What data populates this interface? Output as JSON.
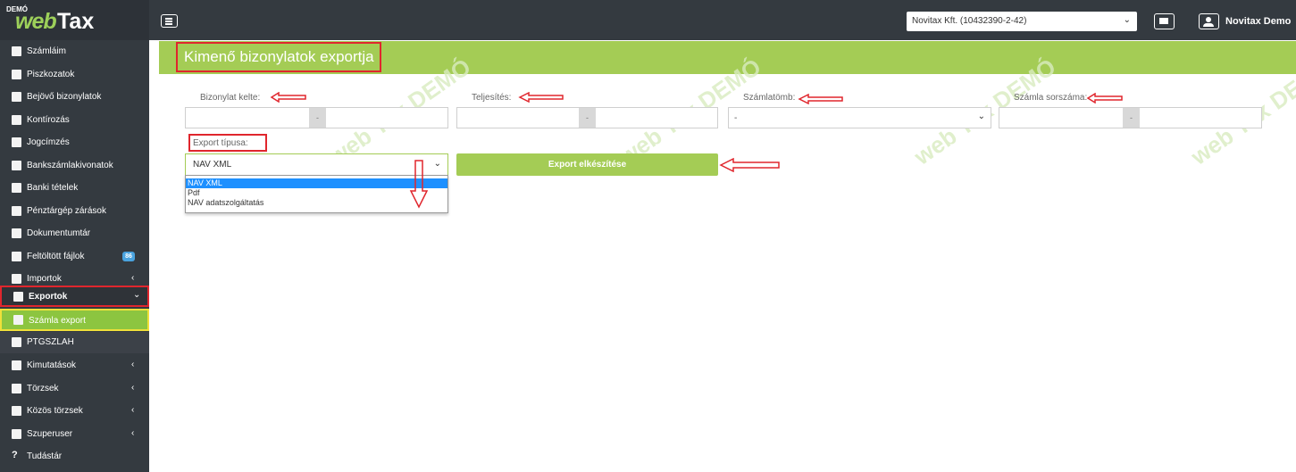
{
  "app": {
    "demo_label": "DEMÓ",
    "logo_web": "web",
    "logo_tax": "Tax"
  },
  "header": {
    "company": "Novitax Kft. (10432390-2-42)",
    "user": "Novitax Demo"
  },
  "sidebar": {
    "items": [
      {
        "label": "Számláim",
        "icon": "file-icon"
      },
      {
        "label": "Piszkozatok",
        "icon": "draft-icon"
      },
      {
        "label": "Bejövő bizonylatok",
        "icon": "incoming-icon"
      },
      {
        "label": "Kontírozás",
        "icon": "edit-icon"
      },
      {
        "label": "Jogcímzés",
        "icon": "edit-icon"
      },
      {
        "label": "Bankszámlakivonatok",
        "icon": "bank-statement-icon"
      },
      {
        "label": "Banki tételek",
        "icon": "bank-items-icon"
      },
      {
        "label": "Pénztárgép zárások",
        "icon": "lock-icon"
      },
      {
        "label": "Dokumentumtár",
        "icon": "archive-icon"
      },
      {
        "label": "Feltöltött fájlok",
        "icon": "upload-icon",
        "badge": "86"
      },
      {
        "label": "Importok",
        "icon": "upload-icon",
        "caret": "‹"
      },
      {
        "label": "Exportok",
        "icon": "download-icon",
        "caret": "⌄"
      },
      {
        "label": "Számla export",
        "icon": "download-icon"
      },
      {
        "label": "PTGSZLAH",
        "icon": "document-icon"
      },
      {
        "label": "Kimutatások",
        "icon": "chart-icon",
        "caret": "‹"
      },
      {
        "label": "Törzsek",
        "icon": "book-icon",
        "caret": "‹"
      },
      {
        "label": "Közös törzsek",
        "icon": "sitemap-icon",
        "caret": "‹"
      },
      {
        "label": "Szuperuser",
        "icon": "users-icon",
        "caret": "‹"
      },
      {
        "label": "Tudástár",
        "icon": "question-icon"
      }
    ]
  },
  "main": {
    "title": "Kimenő bizonylatok exportja",
    "watermark": "web Tax DEMÓ",
    "fields": {
      "date": {
        "label": "Bizonylat kelte:",
        "sep": "-"
      },
      "fulfillment": {
        "label": "Teljesítés:",
        "sep": "-"
      },
      "block": {
        "label": "Számlatömb:",
        "value": "-"
      },
      "serial": {
        "label": "Számla sorszáma:",
        "sep": "-"
      }
    },
    "export_type": {
      "label": "Export típusa:",
      "selected": "NAV XML",
      "options": [
        "NAV XML",
        "Pdf",
        "NAV adatszolgáltatás"
      ]
    },
    "export_button": "Export elkészítése"
  }
}
